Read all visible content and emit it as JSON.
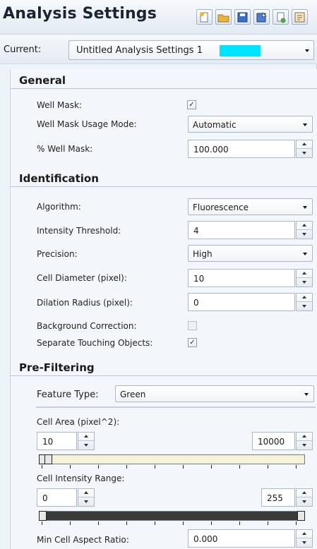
{
  "title": "Analysis Settings",
  "toolbar": {
    "buttons": [
      {
        "name": "new-icon",
        "color": "#f2b62d"
      },
      {
        "name": "open-folder-icon",
        "color": "#e8b43a"
      },
      {
        "name": "save-icon",
        "color": "#3a6fc9"
      },
      {
        "name": "save-as-icon",
        "color": "#4c7fd4"
      },
      {
        "name": "copy-icon",
        "color": "#58a14a"
      },
      {
        "name": "export-icon",
        "color": "#c98b2b"
      }
    ]
  },
  "current": {
    "label": "Current:",
    "value": "Untitled Analysis Settings 1",
    "swatch_color": "#00e5ff"
  },
  "general": {
    "heading": "General",
    "well_mask": {
      "label": "Well Mask:",
      "checked": "✓"
    },
    "usage_mode": {
      "label": "Well Mask Usage Mode:",
      "value": "Automatic"
    },
    "percent_mask": {
      "label": "% Well Mask:",
      "value": "100.000"
    }
  },
  "identification": {
    "heading": "Identification",
    "algorithm": {
      "label": "Algorithm:",
      "value": "Fluorescence"
    },
    "threshold": {
      "label": "Intensity Threshold:",
      "value": "4"
    },
    "precision": {
      "label": "Precision:",
      "value": "High"
    },
    "cell_diameter": {
      "label": "Cell Diameter (pixel):",
      "value": "10"
    },
    "dilation": {
      "label": "Dilation Radius (pixel):",
      "value": "0"
    },
    "background": {
      "label": "Background Correction:",
      "checked": ""
    },
    "separate": {
      "label": "Separate Touching Objects:",
      "checked": "✓"
    }
  },
  "prefilter": {
    "heading": "Pre-Filtering",
    "feature_type": {
      "label": "Feature Type:",
      "value": "Green"
    },
    "cell_area": {
      "label": "Cell Area (pixel^2):",
      "min": "10",
      "max": "10000"
    },
    "intensity": {
      "label": "Cell Intensity Range:",
      "min": "0",
      "max": "255"
    },
    "aspect": {
      "label": "Min Cell Aspect Ratio:",
      "value": "0.000"
    }
  }
}
